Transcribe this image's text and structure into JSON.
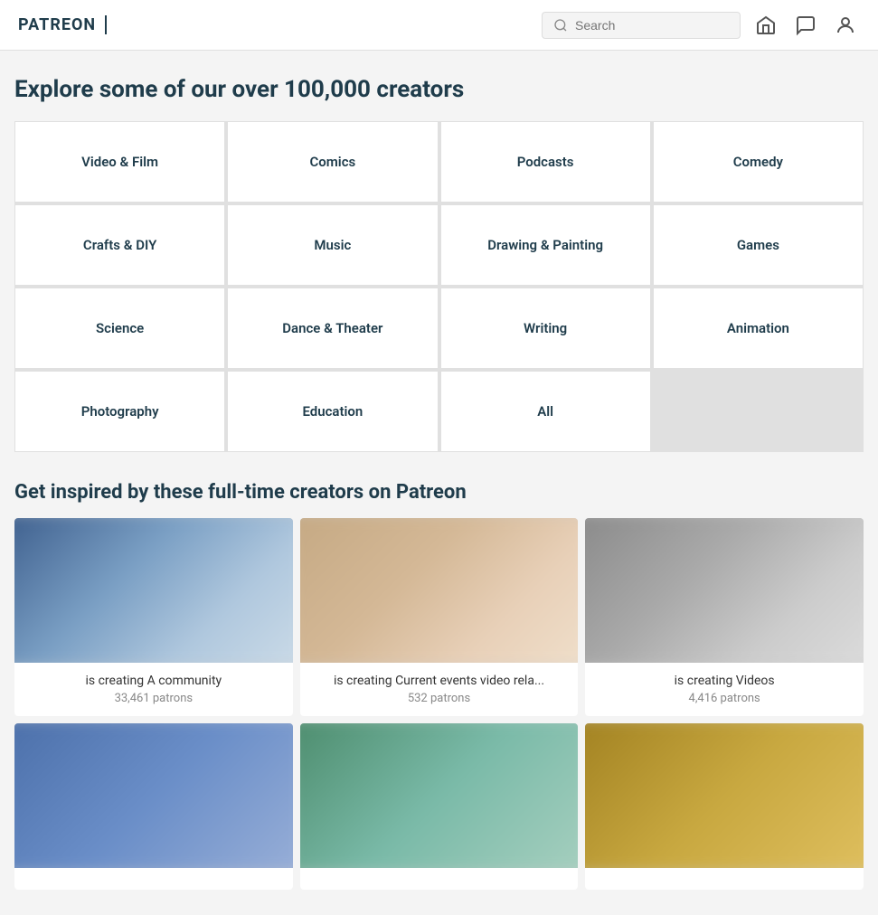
{
  "header": {
    "logo": "PATREON",
    "search_placeholder": "Search",
    "search_value": ""
  },
  "explore": {
    "title": "Explore some of our over 100,000 creators",
    "categories": [
      {
        "id": "video-film",
        "label": "Video & Film"
      },
      {
        "id": "comics",
        "label": "Comics"
      },
      {
        "id": "podcasts",
        "label": "Podcasts"
      },
      {
        "id": "comedy",
        "label": "Comedy"
      },
      {
        "id": "crafts-diy",
        "label": "Crafts & DIY"
      },
      {
        "id": "music",
        "label": "Music"
      },
      {
        "id": "drawing-painting",
        "label": "Drawing & Painting"
      },
      {
        "id": "games",
        "label": "Games"
      },
      {
        "id": "science",
        "label": "Science"
      },
      {
        "id": "dance-theater",
        "label": "Dance & Theater"
      },
      {
        "id": "writing",
        "label": "Writing"
      },
      {
        "id": "animation",
        "label": "Animation"
      },
      {
        "id": "photography",
        "label": "Photography"
      },
      {
        "id": "education",
        "label": "Education"
      },
      {
        "id": "all",
        "label": "All"
      }
    ]
  },
  "inspired": {
    "title": "Get inspired by these full-time creators on Patreon",
    "creators": [
      {
        "id": "creator-1",
        "description": "is creating A community",
        "patrons": "33,461 patrons",
        "bg": "bg-blue"
      },
      {
        "id": "creator-2",
        "description": "is creating Current events video rela...",
        "patrons": "532 patrons",
        "bg": "bg-warm"
      },
      {
        "id": "creator-3",
        "description": "is creating Videos",
        "patrons": "4,416 patrons",
        "bg": "bg-gray"
      },
      {
        "id": "creator-4",
        "description": "",
        "patrons": "",
        "bg": "bg-blue2"
      },
      {
        "id": "creator-5",
        "description": "",
        "patrons": "",
        "bg": "bg-green"
      },
      {
        "id": "creator-6",
        "description": "",
        "patrons": "",
        "bg": "bg-gold"
      }
    ]
  }
}
